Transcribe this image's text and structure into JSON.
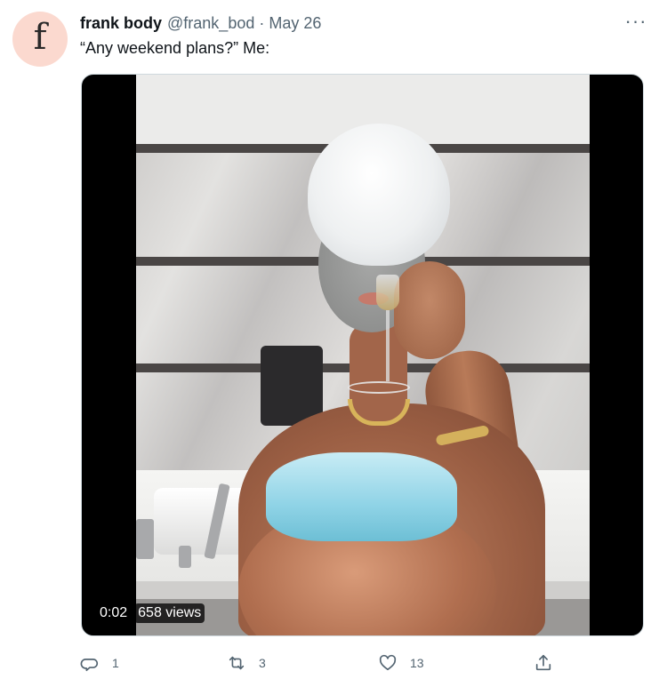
{
  "author": {
    "avatar_letter": "f",
    "name": "frank body",
    "handle": "@frank_bod",
    "separator": "·",
    "date": "May 26"
  },
  "more_label": "···",
  "tweet_text": "“Any weekend plans?” Me:",
  "media": {
    "video_time": "0:02",
    "views": "658 views"
  },
  "actions": {
    "reply_count": "1",
    "retweet_count": "3",
    "like_count": "13"
  },
  "colors": {
    "avatar_bg": "#fbd9cf",
    "secondary_text": "#536471",
    "primary_text": "#0f1419"
  },
  "icons": [
    "reply-icon",
    "retweet-icon",
    "like-icon",
    "share-icon",
    "more-icon"
  ]
}
